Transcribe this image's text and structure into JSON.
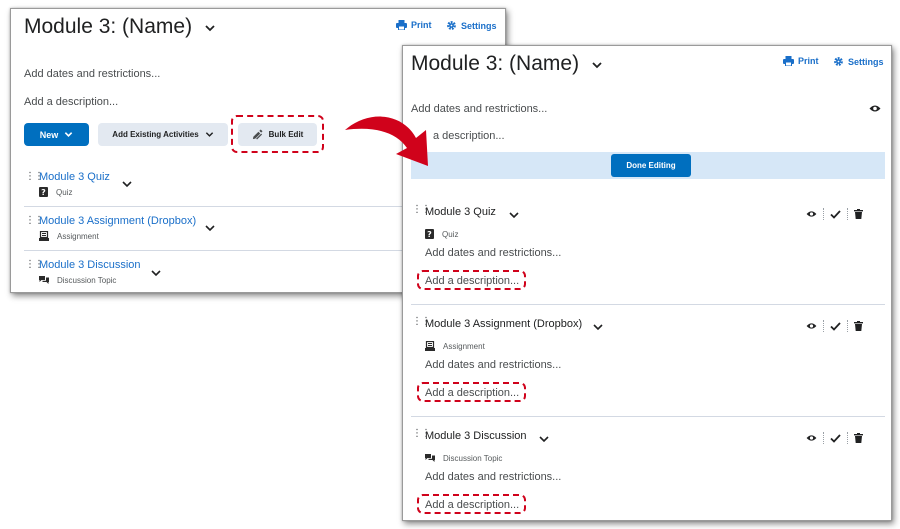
{
  "module": {
    "title": "Module 3: (Name)",
    "print_label": "Print",
    "settings_label": "Settings",
    "dates_text": "Add dates and restrictions...",
    "description_text": "Add a description...",
    "partial_description_text": "a description..."
  },
  "toolbar": {
    "new_label": "New",
    "add_existing_label": "Add Existing Activities",
    "bulk_edit_label": "Bulk Edit",
    "done_editing_label": "Done Editing"
  },
  "items": [
    {
      "title": "Module 3 Quiz",
      "type": "Quiz",
      "icon": "quiz-icon"
    },
    {
      "title": "Module 3 Assignment (Dropbox)",
      "type": "Assignment",
      "icon": "assignment-icon"
    },
    {
      "title": "Module 3 Discussion",
      "type": "Discussion Topic",
      "icon": "discussion-icon"
    }
  ],
  "item_dates_text": "Add dates and restrictions...",
  "item_description_text": "Add a description...",
  "colors": {
    "primary": "#006fbf",
    "link": "#1a6fc9",
    "highlight_bar": "#d6e7f7",
    "secondary_button": "#e3e9f1",
    "annotation_red": "#d0021b"
  }
}
